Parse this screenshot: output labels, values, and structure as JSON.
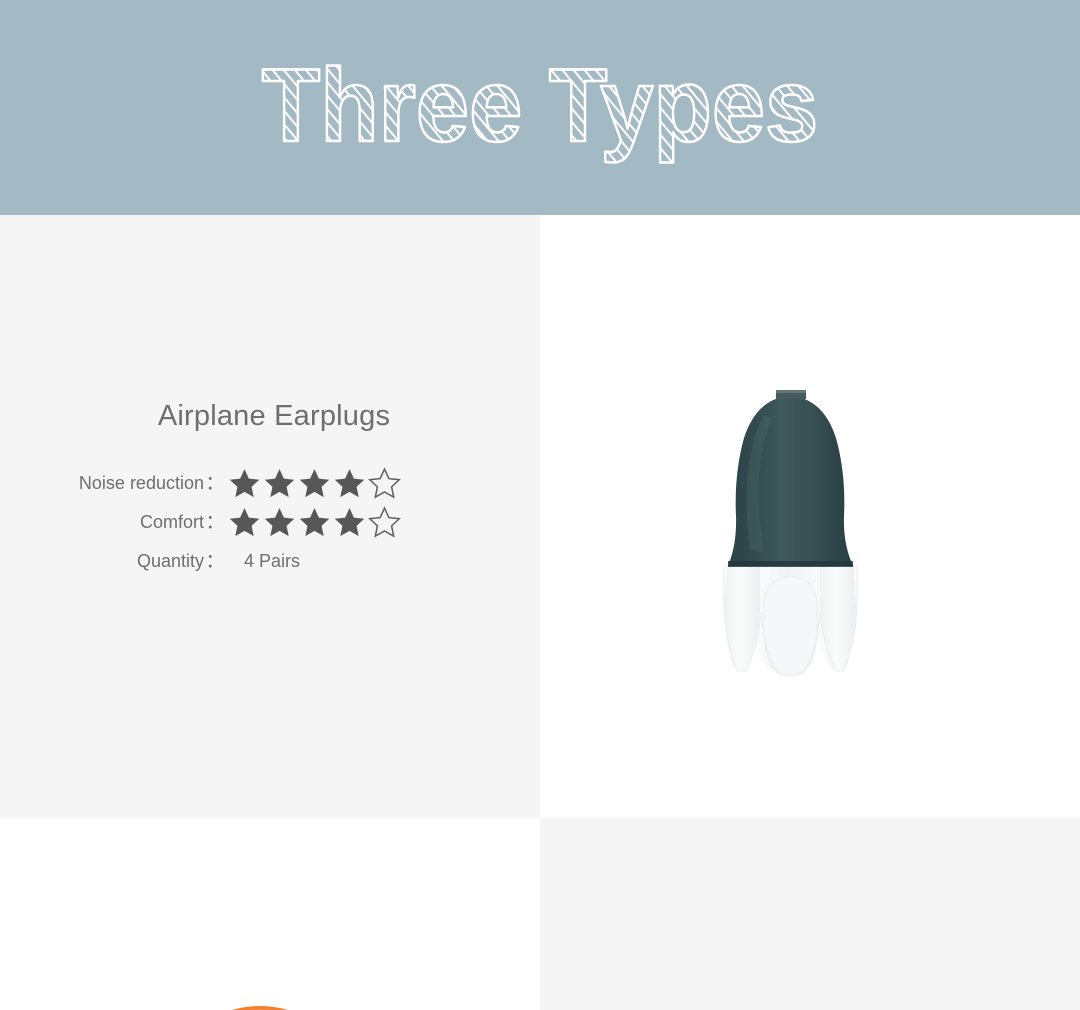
{
  "header": {
    "title": "Three Types",
    "background_color": "#a3b9c4",
    "title_color": "#ffffff"
  },
  "product": {
    "name": "Airplane Earplugs",
    "title_color": "#6e6e6e",
    "image": {
      "alt_name": "airplane-earplug",
      "cap_color": "#31494d",
      "cap_highlight_color": "#446063",
      "base_color": "#f4f5f6",
      "base_shadow_color": "#e2e5e6"
    },
    "specs": [
      {
        "label": "Noise reduction",
        "colon": "：",
        "type": "rating",
        "rating": 4,
        "max_rating": 5,
        "value_text": "★★★★☆"
      },
      {
        "label": "Comfort",
        "colon": "：",
        "type": "rating",
        "rating": 4,
        "max_rating": 5,
        "value_text": "★★★★☆"
      },
      {
        "label": "Quantity",
        "colon": "：",
        "type": "text",
        "value_text": "4 Pairs"
      }
    ]
  },
  "palette": {
    "panel_gray": "#f5f5f5",
    "panel_white": "#ffffff",
    "star_filled": "#575757",
    "star_empty_stroke": "#5e5e5e",
    "label_gray": "#6e6e6e",
    "accent_orange": "#f4802e"
  },
  "partial_next_item": {
    "name": "orange-product-sliver",
    "color": "#f4802e"
  }
}
